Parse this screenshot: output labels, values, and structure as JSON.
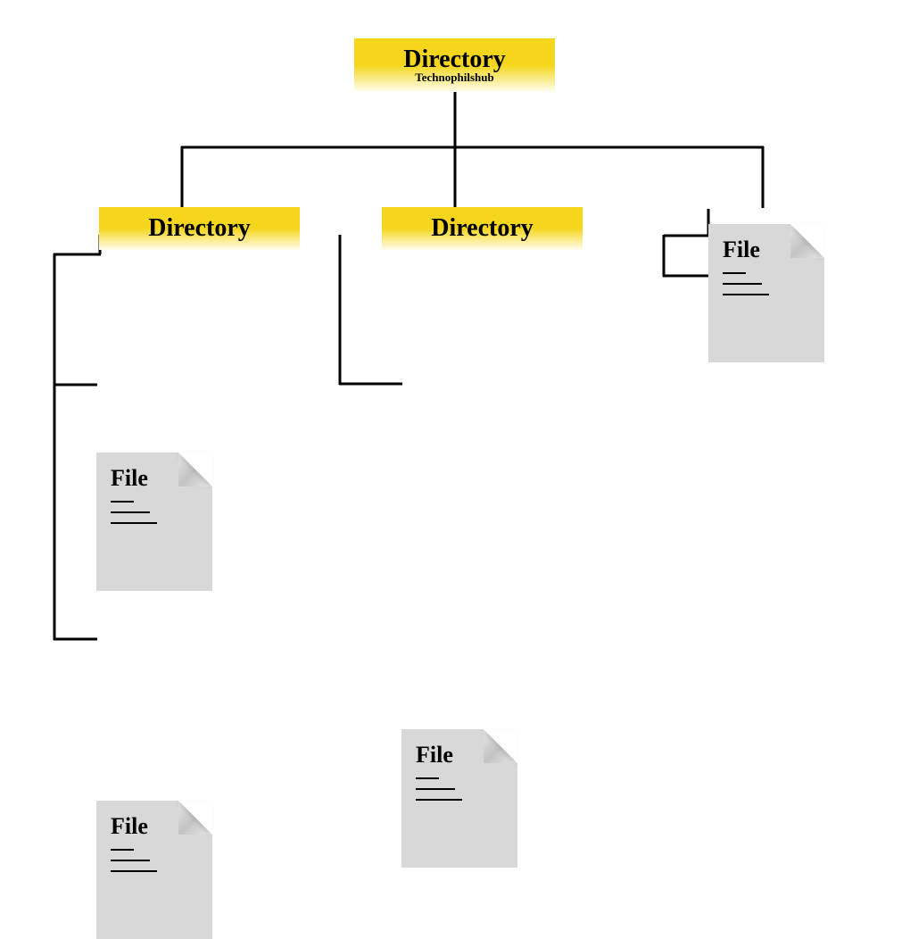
{
  "root": {
    "label": "Directory",
    "sublabel": "Technophilshub"
  },
  "children": {
    "left": {
      "label": "Directory"
    },
    "middle": {
      "label": "Directory"
    },
    "rightFile": {
      "label": "File"
    }
  },
  "leftFiles": {
    "file1": {
      "label": "File"
    },
    "file2": {
      "label": "File"
    }
  },
  "middleFiles": {
    "file1": {
      "label": "File"
    }
  }
}
